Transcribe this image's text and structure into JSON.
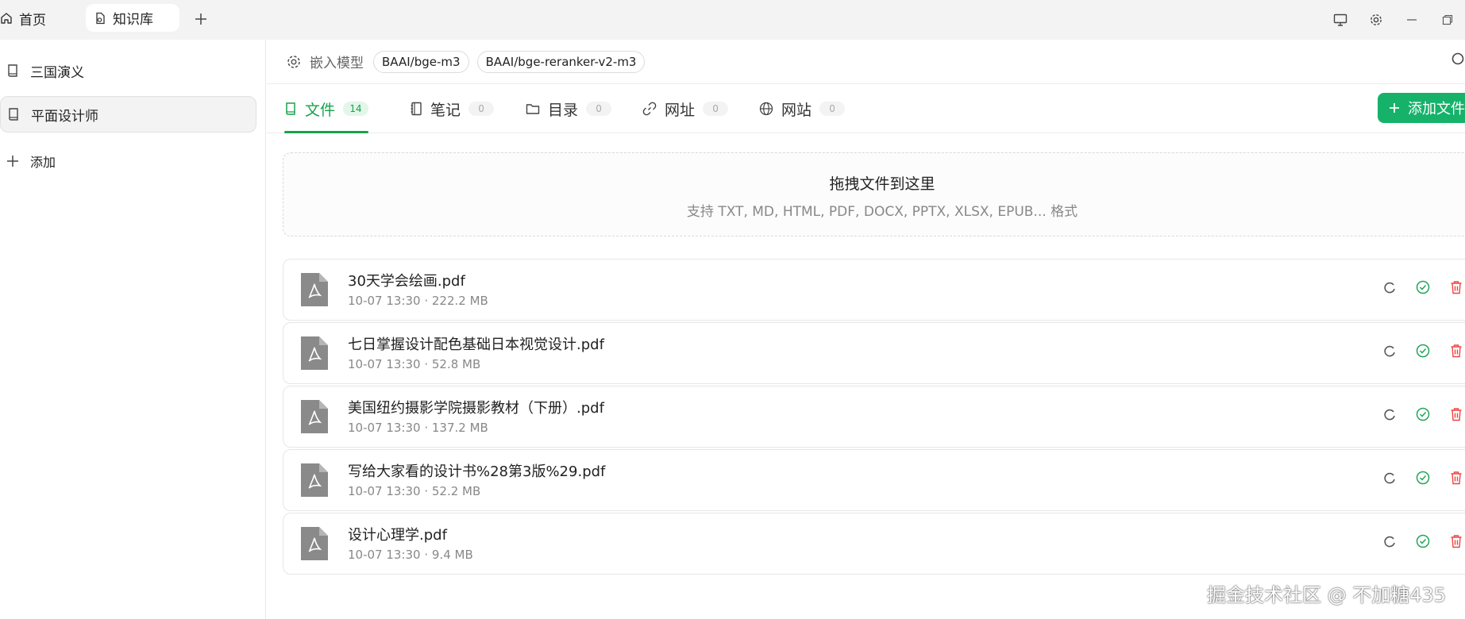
{
  "titlebar": {
    "home_tab": {
      "label": "首页",
      "icon": "home-icon"
    },
    "active_tab": {
      "label": "知识库",
      "icon": "knowledge-icon"
    },
    "add_tab_icon": "plus-icon",
    "controls": [
      "monitor-icon",
      "gear-icon",
      "minimize-icon",
      "restore-icon"
    ]
  },
  "sidebar": {
    "items": [
      {
        "label": "三国演义",
        "icon": "book-icon",
        "selected": false
      },
      {
        "label": "平面设计师",
        "icon": "book-icon",
        "selected": true
      }
    ],
    "add_label": "添加"
  },
  "modelbar": {
    "label": "嵌入模型",
    "models": [
      "BAAI/bge-m3",
      "BAAI/bge-reranker-v2-m3"
    ]
  },
  "tabs": [
    {
      "label": "文件",
      "count": "14",
      "icon": "book-icon",
      "active": true
    },
    {
      "label": "笔记",
      "count": "0",
      "icon": "notebook-icon",
      "active": false
    },
    {
      "label": "目录",
      "count": "0",
      "icon": "folder-icon",
      "active": false
    },
    {
      "label": "网址",
      "count": "0",
      "icon": "link-icon",
      "active": false
    },
    {
      "label": "网站",
      "count": "0",
      "icon": "globe-icon",
      "active": false
    }
  ],
  "add_files_button": "添加文件",
  "dropzone": {
    "title": "拖拽文件到这里",
    "subtitle": "支持 TXT, MD, HTML, PDF, DOCX, PPTX, XLSX, EPUB... 格式"
  },
  "files": [
    {
      "name": "30天学会绘画.pdf",
      "meta": "10-07 13:30 · 222.2 MB"
    },
    {
      "name": "七日掌握设计配色基础日本视觉设计.pdf",
      "meta": "10-07 13:30 · 52.8 MB"
    },
    {
      "name": "美国纽约摄影学院摄影教材（下册）.pdf",
      "meta": "10-07 13:30 · 137.2 MB"
    },
    {
      "name": "写给大家看的设计书%28第3版%29.pdf",
      "meta": "10-07 13:30 · 52.2 MB"
    },
    {
      "name": "设计心理学.pdf",
      "meta": "10-07 13:30 · 9.4 MB"
    }
  ],
  "colors": {
    "accent": "#16a34a",
    "button": "#16b26a",
    "danger": "#ef4444",
    "ok": "#22a55a"
  },
  "watermark": "掘金技术社区 @ 不加糖435"
}
